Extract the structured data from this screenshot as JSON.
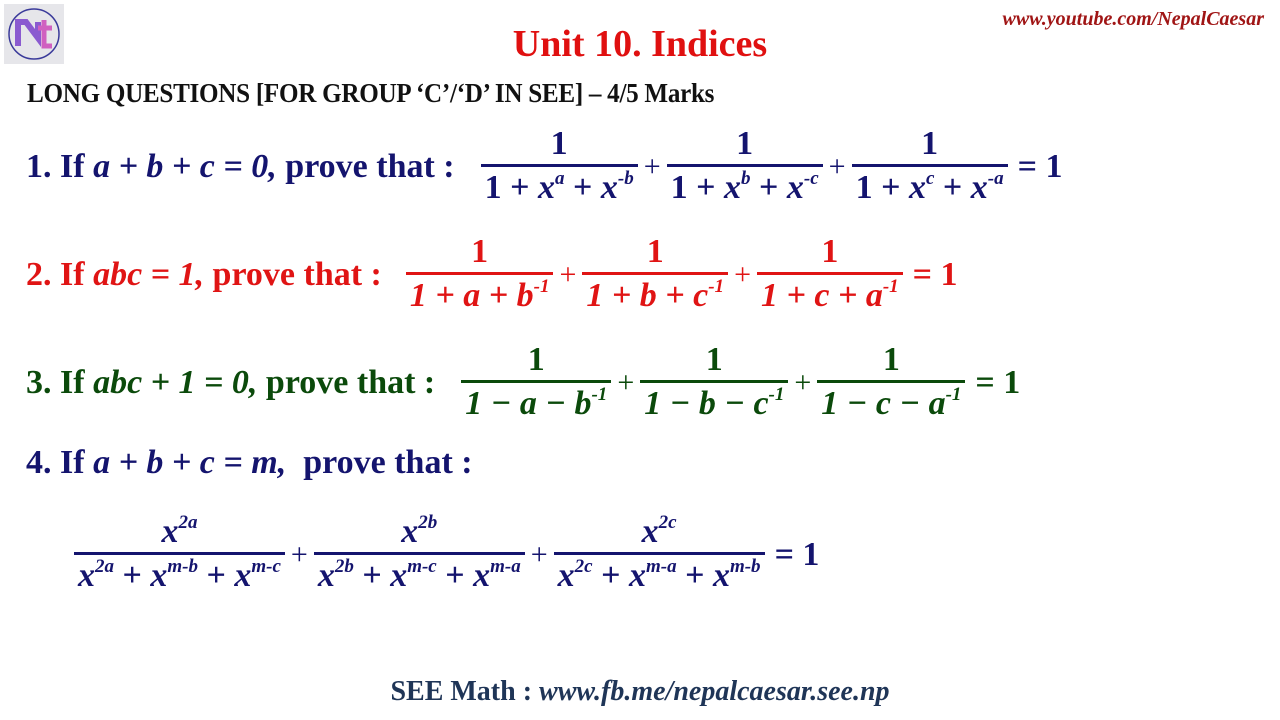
{
  "header": {
    "logo_text": "NC",
    "youtube_link": "www.youtube.com/NepalCaesar",
    "title": "Unit 10. Indices",
    "subtitle": "LONG QUESTIONS [FOR GROUP ‘C’/‘D’ IN SEE] – 4/5 Marks"
  },
  "colors": {
    "navy": "#14146e",
    "red": "#e01414",
    "green": "#0b4a0b",
    "title_red": "#e01010",
    "footer": "#1f3557"
  },
  "questions": [
    {
      "number": "1.",
      "condition_prefix": "If ",
      "condition": "a + b + c = 0,",
      "prove": " prove that :",
      "terms": [
        {
          "num": "1",
          "den": [
            "1 + x",
            "a",
            " + x",
            "-b"
          ]
        },
        {
          "num": "1",
          "den": [
            "1 + x",
            "b",
            " + x",
            "-c"
          ]
        },
        {
          "num": "1",
          "den": [
            "1 + x",
            "c",
            " + x",
            "-a"
          ]
        }
      ],
      "rhs": "= 1"
    },
    {
      "number": "2.",
      "condition_prefix": "If ",
      "condition": "abc = 1,",
      "prove": " prove that :",
      "terms": [
        {
          "num": "1",
          "den": [
            "1 + a + b",
            "-1"
          ]
        },
        {
          "num": "1",
          "den": [
            "1 + b + c",
            "-1"
          ]
        },
        {
          "num": "1",
          "den": [
            "1 + c + a",
            "-1"
          ]
        }
      ],
      "rhs": "= 1"
    },
    {
      "number": "3.",
      "condition_prefix": "If ",
      "condition": "abc + 1 = 0,",
      "prove": " prove that :",
      "terms": [
        {
          "num": "1",
          "den": [
            "1 − a − b",
            "-1"
          ]
        },
        {
          "num": "1",
          "den": [
            "1 − b − c",
            "-1"
          ]
        },
        {
          "num": "1",
          "den": [
            "1 − c − a",
            "-1"
          ]
        }
      ],
      "rhs": "= 1"
    },
    {
      "number": "4.",
      "condition_prefix": "If ",
      "condition": "a + b + c = m,",
      "prove": "  prove that :",
      "terms": [
        {
          "num": [
            "x",
            "2a"
          ],
          "den": [
            "x",
            "2a",
            " + x",
            "m-b",
            " + x",
            "m-c"
          ]
        },
        {
          "num": [
            "x",
            "2b"
          ],
          "den": [
            "x",
            "2b",
            " + x",
            "m-c",
            " + x",
            "m-a"
          ]
        },
        {
          "num": [
            "x",
            "2c"
          ],
          "den": [
            "x",
            "2c",
            " + x",
            "m-a",
            " + x",
            "m-b"
          ]
        }
      ],
      "rhs": "= 1"
    }
  ],
  "plus": "+",
  "footer": {
    "label": "SEE Math : ",
    "link": "www.fb.me/nepalcaesar.see.np"
  }
}
